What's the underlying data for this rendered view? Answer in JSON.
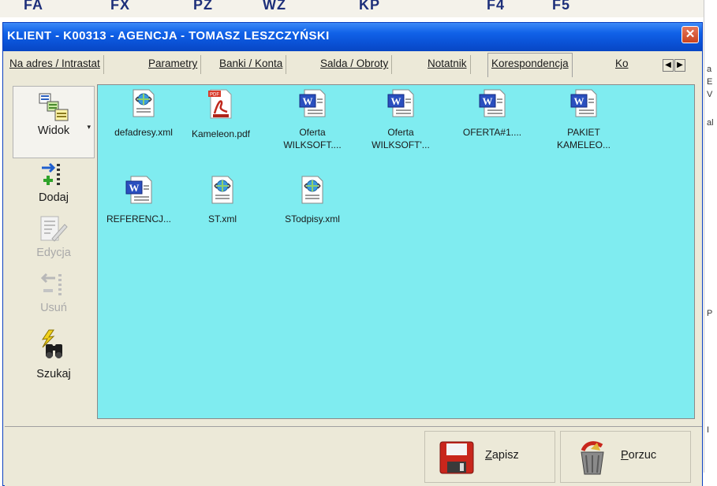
{
  "background": {
    "toolbar_labels": [
      "FA",
      "FX",
      "PZ",
      "WZ",
      "KP",
      "F4",
      "F5"
    ],
    "right_marks": [
      "a",
      "E",
      "V",
      "al",
      "P",
      "I"
    ]
  },
  "dialog": {
    "title": "KLIENT - K00313 - AGENCJA - TOMASZ LESZCZYŃSKI",
    "close_glyph": "✕"
  },
  "tabs": {
    "items": [
      {
        "label": "Na adres / Intrastat"
      },
      {
        "label": "Parametry"
      },
      {
        "label": "Banki / Konta"
      },
      {
        "label": "Salda / Obroty"
      },
      {
        "label": "Notatnik"
      },
      {
        "label": "Korespondencja",
        "active": true
      },
      {
        "label": "Ko"
      }
    ],
    "arrow_left": "◀",
    "arrow_right": "▶"
  },
  "toolbar": {
    "view_label": "Widok",
    "view_caret": "▾",
    "add_label": "Dodaj",
    "edit_label": "Edycja",
    "delete_label": "Usuń",
    "search_label": "Szukaj"
  },
  "files": [
    {
      "name": "defadresy.xml",
      "type": "xml"
    },
    {
      "name": "Kameleon.pdf",
      "type": "pdf"
    },
    {
      "name": "Oferta WILKSOFT....",
      "type": "doc"
    },
    {
      "name": "Oferta WILKSOFT'...",
      "type": "doc"
    },
    {
      "name": "OFERTA#1....",
      "type": "doc"
    },
    {
      "name": "PAKIET KAMELEO...",
      "type": "doc"
    },
    {
      "name": "REFERENCJ...",
      "type": "doc"
    },
    {
      "name": "ST.xml",
      "type": "xml"
    },
    {
      "name": "STodpisy.xml",
      "type": "xml"
    }
  ],
  "footer": {
    "save_hotkey": "Z",
    "save_rest": "apisz",
    "cancel_hotkey": "P",
    "cancel_rest": "orzuc"
  },
  "colors": {
    "file_area_bg": "#7fecf0",
    "titlebar": "#0a52d6",
    "dialog_bg": "#ece9d8"
  }
}
